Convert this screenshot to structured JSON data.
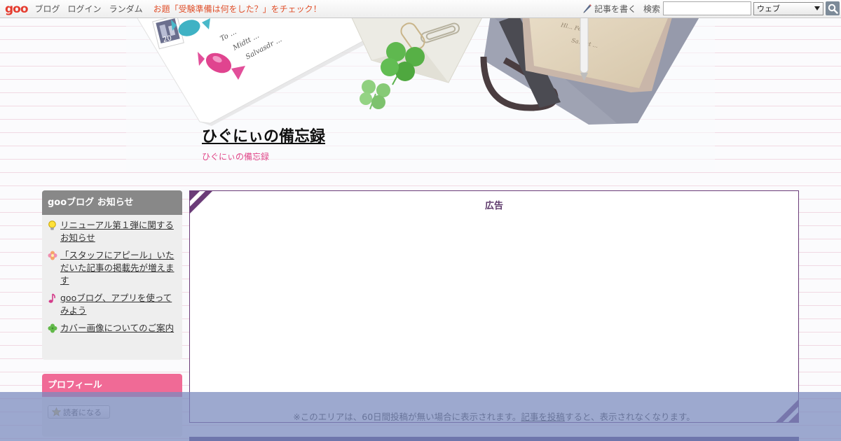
{
  "topbar": {
    "logo": "goo",
    "nav": [
      "ブログ",
      "ログイン",
      "ランダム"
    ],
    "topic_link": "お題「受験準備は何をした？」をチェック！",
    "write_label": "記事を書く",
    "search_label": "検索",
    "search_value": "",
    "search_scope": "ウェブ",
    "icons": {
      "write": "pencil-icon",
      "search_button": "magnifier-icon",
      "select": "triangle-down-icon"
    }
  },
  "header": {
    "title": "ひぐにぃの備忘録",
    "subtitle": "ひぐにぃの備忘録",
    "stamp_number": "20",
    "card_text_lines": [
      "To ...",
      "Midtt ...",
      "Salvasdr ..."
    ]
  },
  "sidebar": {
    "notices": {
      "heading": "gooブログ お知らせ",
      "items": [
        {
          "icon": "lightbulb-icon",
          "label": "リニューアル第１弾に関するお知らせ"
        },
        {
          "icon": "flower-icon",
          "label": "「スタッフにアピール」いただいた記事の掲載先が増えます"
        },
        {
          "icon": "music-note-icon",
          "label": "gooブログ、アプリを使ってみよう"
        },
        {
          "icon": "clover-icon",
          "label": "カバー画像についてのご案内"
        }
      ]
    },
    "profile": {
      "heading": "プロフィール",
      "follow_label": "読者になる",
      "follow_icon": "star-icon"
    }
  },
  "main": {
    "ad_label": "広告",
    "ad_note_before": "※このエリアは、60日間投稿が無い場合に表示されます。",
    "ad_note_link": "記事を投稿",
    "ad_note_after": "すると、表示されなくなります。"
  },
  "colors": {
    "logo": "#e53c2f",
    "topic_link": "#e0502b",
    "subtitle": "#e04688",
    "notice_header": "#888888",
    "profile_header": "#f06a96",
    "ad_border": "#6b3c78",
    "overlay": "#7b8bbe"
  }
}
